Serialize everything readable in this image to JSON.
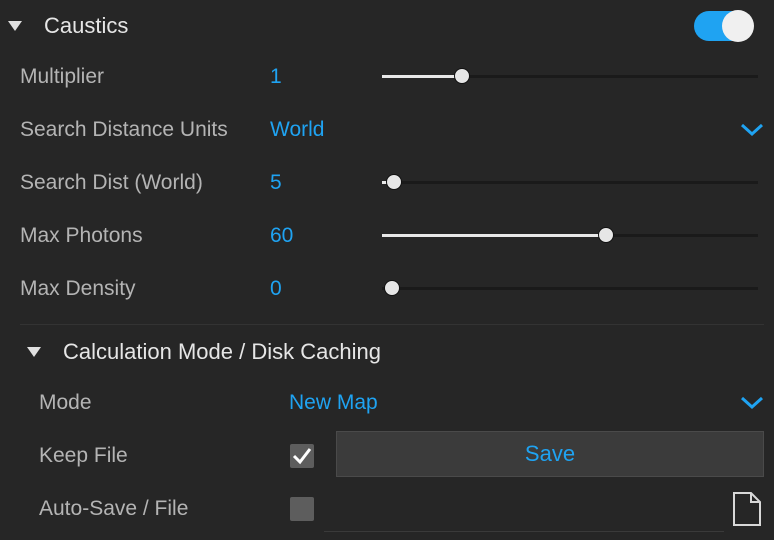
{
  "caustics": {
    "title": "Caustics",
    "enabled": true,
    "params": {
      "multiplier": {
        "label": "Multiplier",
        "value": "1",
        "slider_fraction": 0.2
      },
      "search_units": {
        "label": "Search Distance Units",
        "value": "World"
      },
      "search_dist": {
        "label": "Search Dist (World)",
        "value": "5",
        "slider_fraction": 0.03
      },
      "max_photons": {
        "label": "Max Photons",
        "value": "60",
        "slider_fraction": 0.6
      },
      "max_density": {
        "label": "Max Density",
        "value": "0",
        "slider_fraction": 0.0
      }
    }
  },
  "calc_mode": {
    "title": "Calculation Mode / Disk Caching",
    "mode": {
      "label": "Mode",
      "value": "New Map"
    },
    "keep_file": {
      "label": "Keep File",
      "checked": true
    },
    "save_label": "Save",
    "auto_save": {
      "label": "Auto-Save / File",
      "checked": false
    }
  },
  "colors": {
    "accent": "#1fa3f2",
    "background": "#262626"
  },
  "icons": [
    "expand-triangle-icon",
    "chevron-down-icon",
    "checkmark-icon",
    "file-icon"
  ]
}
